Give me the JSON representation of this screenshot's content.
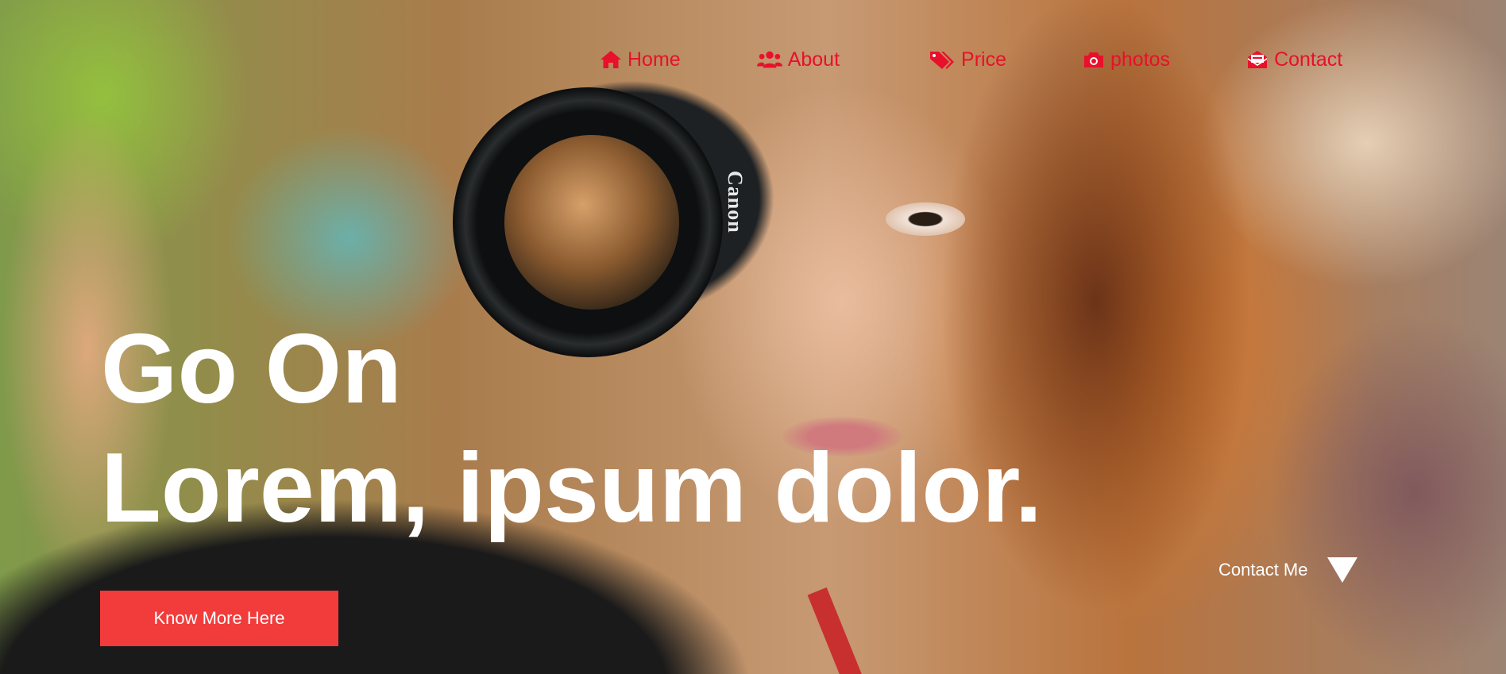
{
  "nav": {
    "items": [
      {
        "label": "Home",
        "icon": "home-icon"
      },
      {
        "label": "About",
        "icon": "users-icon"
      },
      {
        "label": "Price",
        "icon": "tags-icon"
      },
      {
        "label": "photos",
        "icon": "camera-icon"
      },
      {
        "label": "Contact",
        "icon": "envelope-open-icon"
      }
    ],
    "color": "#e8102a"
  },
  "hero": {
    "headline_line1": "Go On",
    "headline_line2": "Lorem, ipsum dolor.",
    "cta_label": "Know More Here",
    "cta_color": "#f23b3b",
    "contact_label": "Contact Me",
    "contact_icon": "triangle-down-icon"
  },
  "photo": {
    "camera_brand_text": "Canon"
  }
}
